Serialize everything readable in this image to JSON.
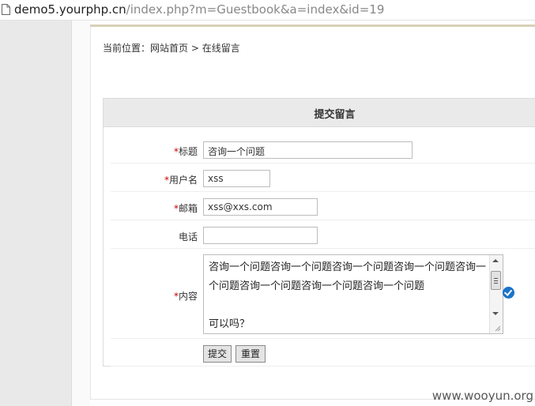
{
  "address_bar": {
    "host": "demo5.yourphp.cn",
    "path": "/index.php?m=Guestbook&a=index&id=19"
  },
  "breadcrumb": {
    "label": "当前位置：",
    "home": "网站首页",
    "separator": ">",
    "current": "在线留言"
  },
  "form": {
    "title": "提交留言",
    "required_mark": "*",
    "fields": {
      "title": {
        "label": "标题",
        "required": true,
        "value": "咨询一个问题"
      },
      "username": {
        "label": "用户名",
        "required": true,
        "value": "xss"
      },
      "email": {
        "label": "邮箱",
        "required": true,
        "value": "xss@xxs.com"
      },
      "phone": {
        "label": "电话",
        "required": false,
        "value": ""
      },
      "content": {
        "label": "内容",
        "required": true,
        "line1": "咨询一个问题咨询一个问题咨询一个问题咨询一个问题咨询一个问题咨询一个问题咨询一个问题咨询一个问题",
        "line2": "可以吗？"
      }
    },
    "submit_label": "提交",
    "reset_label": "重置"
  },
  "watermark": "www.wooyun.org",
  "icons": {
    "page": "page-icon",
    "valid": "checkmark-icon"
  },
  "colors": {
    "required": "#cc0000",
    "valid_check": "#1a73c8"
  }
}
